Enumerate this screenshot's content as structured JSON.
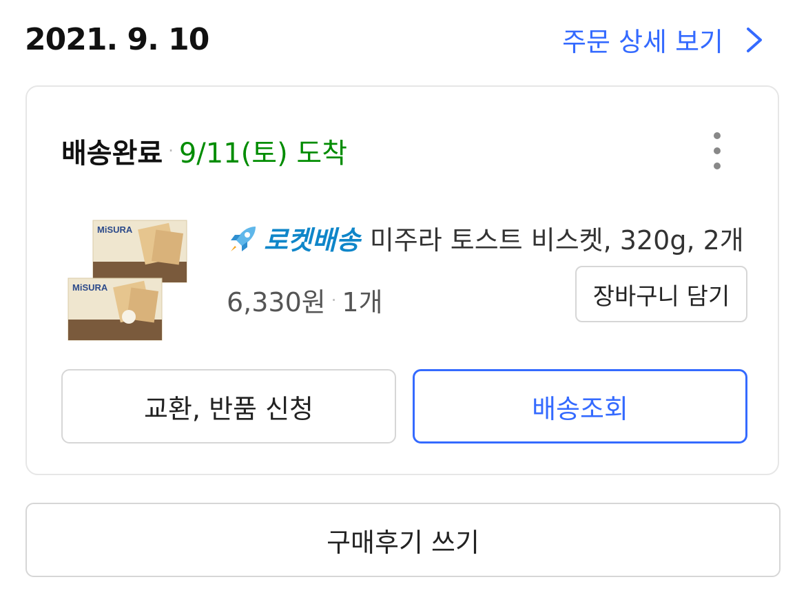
{
  "order": {
    "date": "2021. 9. 10",
    "detail_link": "주문 상세 보기"
  },
  "card": {
    "status": "배송완료",
    "separator": "·",
    "arrival": "9/11(토) 도착",
    "product": {
      "badge": "로켓배송",
      "title": "미주라 토스트 비스켓, 320g, 2개",
      "price": "6,330원",
      "separator": "·",
      "quantity": "1개",
      "image_brand": "MiSURA",
      "add_to_cart": "장바구니 담기"
    },
    "actions": {
      "return_label": "교환, 반품 신청",
      "track_label": "배송조회"
    }
  },
  "review_label": "구매후기 쓰기",
  "colors": {
    "link": "#346aff",
    "arrival": "#008c00",
    "rocket": "#0f86c9"
  }
}
